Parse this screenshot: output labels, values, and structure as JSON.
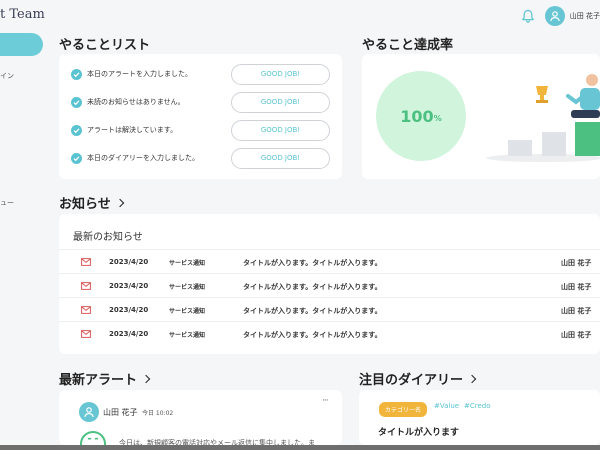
{
  "app": {
    "brand": "t Team",
    "username": "山田 花子"
  },
  "sidebar": {
    "items": [
      "イン",
      "ュー"
    ]
  },
  "todo": {
    "title": "やることリスト",
    "items": [
      {
        "text": "本日のアラートを入力しました。",
        "button": "GOOD JOB!"
      },
      {
        "text": "未読のお知らせはありません。",
        "button": "GOOD JOB!"
      },
      {
        "text": "アラートは解決しています。",
        "button": "GOOD JOB!"
      },
      {
        "text": "本日のダイアリーを入力しました。",
        "button": "GOOD JOB!"
      }
    ]
  },
  "achievement": {
    "title": "やること達成率",
    "percent": "100",
    "unit": "%"
  },
  "news": {
    "title": "お知らせ",
    "subtitle": "最新のお知らせ",
    "rows": [
      {
        "date": "2023/4/20",
        "category": "サービス通知",
        "title": "タイトルが入ります。タイトルが入ります。",
        "author": "山田 花子"
      },
      {
        "date": "2023/4/20",
        "category": "サービス通知",
        "title": "タイトルが入ります。タイトルが入ります。",
        "author": "山田 花子"
      },
      {
        "date": "2023/4/20",
        "category": "サービス通知",
        "title": "タイトルが入ります。タイトルが入ります。",
        "author": "山田 花子"
      },
      {
        "date": "2023/4/20",
        "category": "サービス通知",
        "title": "タイトルが入ります。タイトルが入ります。",
        "author": "山田 花子"
      }
    ]
  },
  "alerts": {
    "title": "最新アラート",
    "author": "山田 花子",
    "time": "今日 10:02",
    "more": "···",
    "text": "今日は、新規顧客の電話対応やメール返信に集中しました。ま"
  },
  "diary": {
    "title": "注目のダイアリー",
    "category": "カテゴリー名",
    "tags": [
      "#Value",
      "#Credo"
    ],
    "entry_title": "タイトルが入ります"
  },
  "colors": {
    "accent": "#5ac3d1",
    "success": "#4cc080",
    "alert": "#e05a5a",
    "tag": "#f2b53c"
  }
}
